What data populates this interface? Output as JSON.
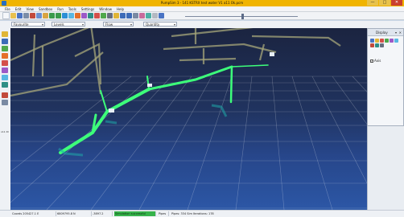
{
  "window": {
    "title": "PumpSim 3  -  141 KSTRX test water  V1 a11 Ok.pcm",
    "minimize_glyph": "—",
    "maximize_glyph": "□",
    "close_glyph": "✕"
  },
  "menu": [
    "File",
    "Edit",
    "View",
    "Sandbox",
    "Run",
    "Tools",
    "Settings",
    "Window",
    "Help"
  ],
  "optionbar": {
    "combo1": "Favourite",
    "combo2": "Levels",
    "combo3": "Flow",
    "combo4": "Quantity"
  },
  "left_toolbar": {
    "label": "o11 ID"
  },
  "display_panel": {
    "title": "Display",
    "pin_glyph": "▾",
    "close_glyph": "✕",
    "checkbox_label": "Axis",
    "checkbox_checked": true
  },
  "status": {
    "coords_e": "Coords 205427.1 E",
    "coords_n": "6809795.8 N",
    "coords_z": "-3897.2",
    "sim_status": "Simulation successful",
    "pipes": "Pipes",
    "pipes_info": "Pipes: 334 Sim Iterations: 178"
  },
  "colors": {
    "pipe_active": "#3dff7a",
    "pipe_inactive": "#8a8f76",
    "grid": "#ffffff",
    "status_ok": "#36b34a",
    "titlebar": "#f0b400"
  }
}
